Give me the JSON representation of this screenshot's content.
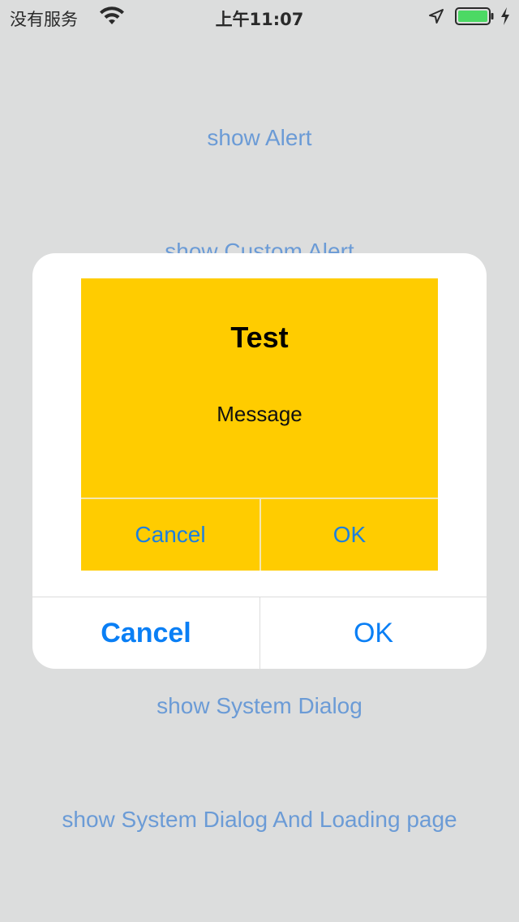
{
  "status_bar": {
    "carrier": "没有服务",
    "time": "上午11:07",
    "wifi_icon": "wifi-icon",
    "location_icon": "location-arrow-icon",
    "battery_icon": "battery-icon",
    "charging_icon": "charging-bolt-icon",
    "battery_color": "#4cd964"
  },
  "background": {
    "links": [
      "show Alert",
      "show Custom Alert",
      "show System Dialog",
      "show System Dialog And Loading page"
    ],
    "link_color": "#6b9bd6"
  },
  "alert": {
    "custom_view": {
      "title": "Test",
      "message": "Message",
      "cancel_label": "Cancel",
      "ok_label": "OK",
      "background_color": "#ffcc00"
    },
    "cancel_label": "Cancel",
    "ok_label": "OK",
    "accent_color": "#0a7ff5"
  }
}
